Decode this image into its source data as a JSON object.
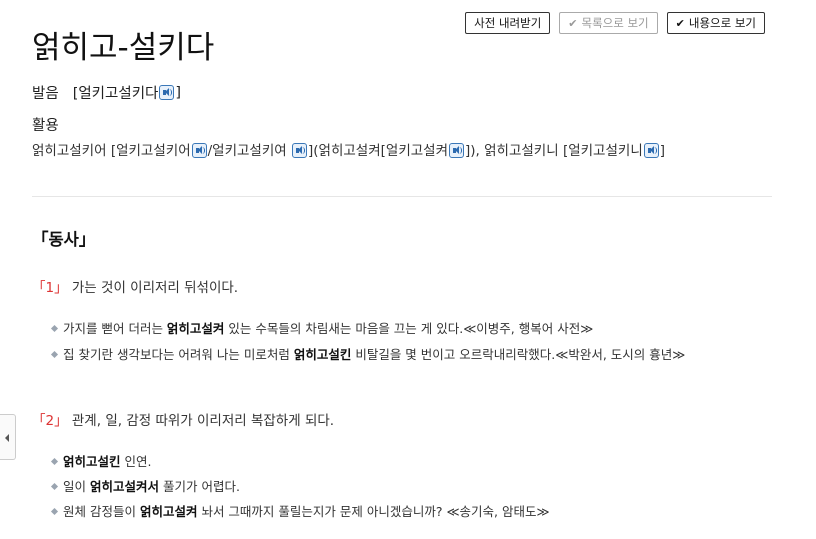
{
  "toolbar": {
    "download_label": "사전 내려받기",
    "list_view_label": "목록으로 보기",
    "content_view_label": "내용으로 보기"
  },
  "entry": {
    "headword": "얽히고-설키다",
    "pronunciation_label": "발음",
    "pronunciation": "[얼키고설키다",
    "pronunciation_close": "]",
    "conjugation_label": "활용",
    "conjugations": {
      "c1_form": "얽히고설키어",
      "c1_pron": "[얼키고설키어",
      "c2_pron": "/얼키고설키여",
      "c3_open": "](얽히고설켜",
      "c3_pron": "[얼키고설켜",
      "c4_form": "]), 얽히고설키니",
      "c4_pron": "[얼키고설키니",
      "close": "]"
    },
    "pos_label": "「동사」",
    "senses": [
      {
        "num": "「1」",
        "definition": "가는 것이 이리저리 뒤섞이다.",
        "examples": [
          {
            "pre": "가지를 뻗어 더러는 ",
            "bold": "얽히고설켜",
            "post": " 있는 수목들의 차림새는 마음을 끄는 게 있다.≪이병주, 행복어 사전≫"
          },
          {
            "pre": "집 찾기란 생각보다는 어려워 나는 미로처럼 ",
            "bold": "얽히고설킨",
            "post": " 비탈길을 몇 번이고 오르락내리락했다.≪박완서, 도시의 흉년≫"
          }
        ]
      },
      {
        "num": "「2」",
        "definition": "관계, 일, 감정 따위가 이리저리 복잡하게 되다.",
        "examples": [
          {
            "pre": "",
            "bold": "얽히고설킨",
            "post": " 인연."
          },
          {
            "pre": "일이 ",
            "bold": "얽히고설켜서",
            "post": " 풀기가 어렵다."
          },
          {
            "pre": "원체 감정들이 ",
            "bold": "얽히고설켜",
            "post": " 놔서 그때까지 풀릴는지가 문제 아니겠습니까? ≪송기숙, 암태도≫"
          }
        ]
      }
    ]
  },
  "icons": {
    "speaker": "speaker-icon",
    "check": "check-icon",
    "side_toggle": "chevron-left-icon"
  }
}
